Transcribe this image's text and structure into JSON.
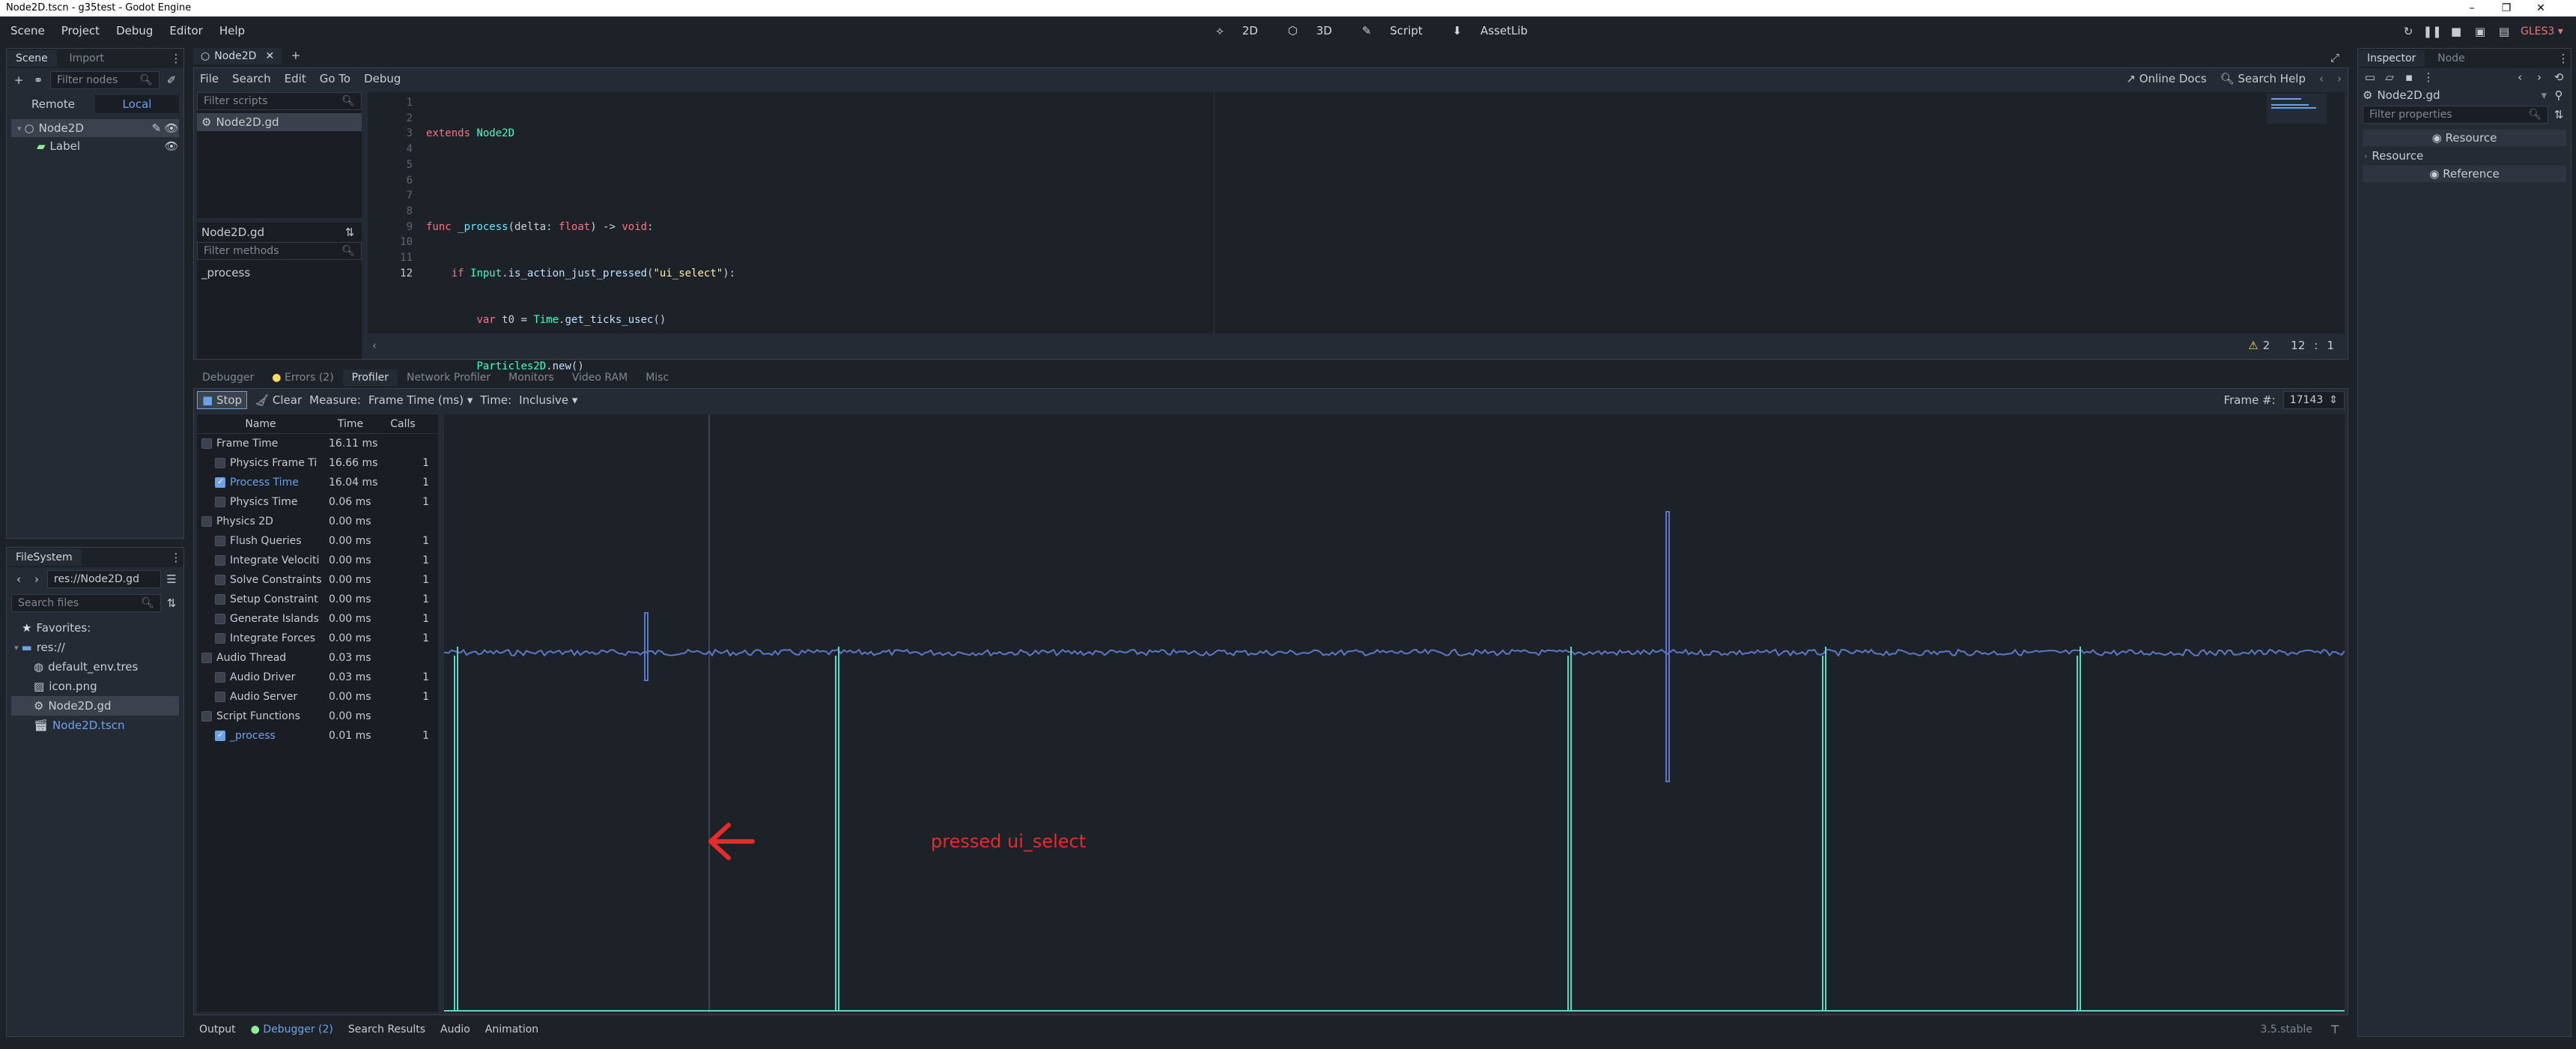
{
  "window": {
    "title": "Node2D.tscn - g35test - Godot Engine",
    "minimize": "–",
    "maximize": "❐",
    "close": "✕"
  },
  "menu": [
    "Scene",
    "Project",
    "Debug",
    "Editor",
    "Help"
  ],
  "main_modes": [
    {
      "icon": "2d-icon",
      "label": "2D"
    },
    {
      "icon": "3d-icon",
      "label": "3D"
    },
    {
      "icon": "script-icon",
      "label": "Script"
    },
    {
      "icon": "assetlib-icon",
      "label": "AssetLib"
    }
  ],
  "renderer": "GLES3",
  "scene_dock": {
    "tabs": [
      "Scene",
      "Import"
    ],
    "filter_placeholder": "Filter nodes",
    "remote": "Remote",
    "local": "Local",
    "nodes": [
      {
        "name": "Node2D",
        "depth": 0
      },
      {
        "name": "Label",
        "depth": 1
      }
    ]
  },
  "filesystem": {
    "tab": "FileSystem",
    "path": "res://Node2D.gd",
    "search_placeholder": "Search files",
    "items": [
      {
        "name": "Favorites:",
        "depth": 0,
        "icon": "star-icon"
      },
      {
        "name": "res://",
        "depth": 0,
        "icon": "folder-icon"
      },
      {
        "name": "default_env.tres",
        "depth": 1,
        "icon": "globe-icon"
      },
      {
        "name": "icon.png",
        "depth": 1,
        "icon": "image-icon"
      },
      {
        "name": "Node2D.gd",
        "depth": 1,
        "icon": "gear-icon",
        "selected": true
      },
      {
        "name": "Node2D.tscn",
        "depth": 1,
        "icon": "scene-icon"
      }
    ]
  },
  "script_editor": {
    "tab": "Node2D",
    "menu": [
      "File",
      "Search",
      "Edit",
      "Go To",
      "Debug"
    ],
    "online_docs": "Online Docs",
    "search_help": "Search Help",
    "filter_scripts_placeholder": "Filter scripts",
    "scripts": [
      "Node2D.gd"
    ],
    "current_script": "Node2D.gd",
    "filter_methods_placeholder": "Filter methods",
    "methods": [
      "_process"
    ],
    "warnings": "2",
    "cursor_line": "12",
    "cursor_col": "1",
    "line_numbers": [
      "1",
      "2",
      "3",
      "4",
      "5",
      "6",
      "7",
      "8",
      "9",
      "10",
      "11",
      "12"
    ]
  },
  "bottom_tabs": {
    "debugger_tabs": [
      "Debugger",
      "Errors (2)",
      "Profiler",
      "Network Profiler",
      "Monitors",
      "Video RAM",
      "Misc"
    ],
    "stop": "Stop",
    "clear": "Clear",
    "measure_label": "Measure:",
    "measure_value": "Frame Time (ms)",
    "time_label": "Time:",
    "time_value": "Inclusive",
    "frame_label": "Frame #:",
    "frame_value": "17143"
  },
  "profiler_table": {
    "headers": [
      "Name",
      "Time",
      "Calls"
    ],
    "rows": [
      {
        "name": "Frame Time",
        "time": "16.11 ms",
        "calls": "",
        "depth": 0,
        "checked": false
      },
      {
        "name": "Physics Frame Ti",
        "time": "16.66 ms",
        "calls": "1",
        "depth": 1,
        "checked": false
      },
      {
        "name": "Process Time",
        "time": "16.04 ms",
        "calls": "1",
        "depth": 1,
        "checked": true
      },
      {
        "name": "Physics Time",
        "time": "0.06 ms",
        "calls": "1",
        "depth": 1,
        "checked": false
      },
      {
        "name": "Physics 2D",
        "time": "0.00 ms",
        "calls": "",
        "depth": 0,
        "checked": false
      },
      {
        "name": "Flush Queries",
        "time": "0.00 ms",
        "calls": "1",
        "depth": 1,
        "checked": false
      },
      {
        "name": "Integrate Velociti",
        "time": "0.00 ms",
        "calls": "1",
        "depth": 1,
        "checked": false
      },
      {
        "name": "Solve Constraints",
        "time": "0.00 ms",
        "calls": "1",
        "depth": 1,
        "checked": false
      },
      {
        "name": "Setup Constraint",
        "time": "0.00 ms",
        "calls": "1",
        "depth": 1,
        "checked": false
      },
      {
        "name": "Generate Islands",
        "time": "0.00 ms",
        "calls": "1",
        "depth": 1,
        "checked": false
      },
      {
        "name": "Integrate Forces",
        "time": "0.00 ms",
        "calls": "1",
        "depth": 1,
        "checked": false
      },
      {
        "name": "Audio Thread",
        "time": "0.03 ms",
        "calls": "",
        "depth": 0,
        "checked": false
      },
      {
        "name": "Audio Driver",
        "time": "0.03 ms",
        "calls": "1",
        "depth": 1,
        "checked": false
      },
      {
        "name": "Audio Server",
        "time": "0.00 ms",
        "calls": "1",
        "depth": 1,
        "checked": false
      },
      {
        "name": "Script Functions",
        "time": "0.00 ms",
        "calls": "",
        "depth": 0,
        "checked": false
      },
      {
        "name": "_process",
        "time": "0.01 ms",
        "calls": "1",
        "depth": 1,
        "checked": true
      }
    ]
  },
  "annotation": {
    "text": "pressed ui_select",
    "color": "#e52b2b"
  },
  "inspector": {
    "tabs": [
      "Inspector",
      "Node"
    ],
    "resource_name": "Node2D.gd",
    "filter_placeholder": "Filter properties",
    "resource_btn": "Resource",
    "resource_section": "Resource",
    "reference_btn": "Reference"
  },
  "bottom_panel": {
    "tabs": [
      "Output",
      "Debugger (2)",
      "Search Results",
      "Audio",
      "Animation"
    ],
    "version": "3.5.stable"
  },
  "colors": {
    "accent": "#6ea2e6",
    "graph_blue": "#5b78c8",
    "graph_teal": "#5ed5c0",
    "bg": "#1d2229",
    "panel": "#252b34"
  }
}
